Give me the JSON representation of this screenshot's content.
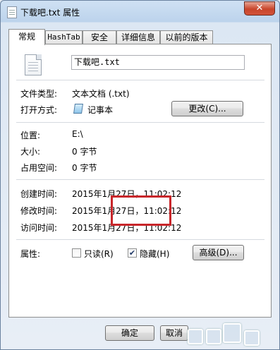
{
  "window": {
    "title": "下载吧.txt 属性",
    "close": "✕"
  },
  "tabs": [
    "常规",
    "HashTab",
    "安全",
    "详细信息",
    "以前的版本"
  ],
  "general": {
    "filename": "下载吧.txt",
    "type_label": "文件类型:",
    "type_value": "文本文档 (.txt)",
    "open_label": "打开方式:",
    "open_value": "记事本",
    "change_button": "更改(C)...",
    "location_label": "位置:",
    "location_value": "E:\\",
    "size_label": "大小:",
    "size_value": "0 字节",
    "disk_label": "占用空间:",
    "disk_value": "0 字节",
    "created_label": "创建时间:",
    "created_value": "2015年1月27日，11:02:12",
    "modified_label": "修改时间:",
    "modified_value": "2015年1月27日，11:02:12",
    "accessed_label": "访问时间:",
    "accessed_value": "2015年1月27日，11:02:12",
    "attributes_label": "属性:",
    "readonly_label": "只读(R)",
    "readonly_checked": false,
    "hidden_label": "隐藏(H)",
    "hidden_checked": true,
    "advanced_button": "高级(D)..."
  },
  "footer": {
    "ok_button": "确定",
    "cancel_button": "取消"
  }
}
